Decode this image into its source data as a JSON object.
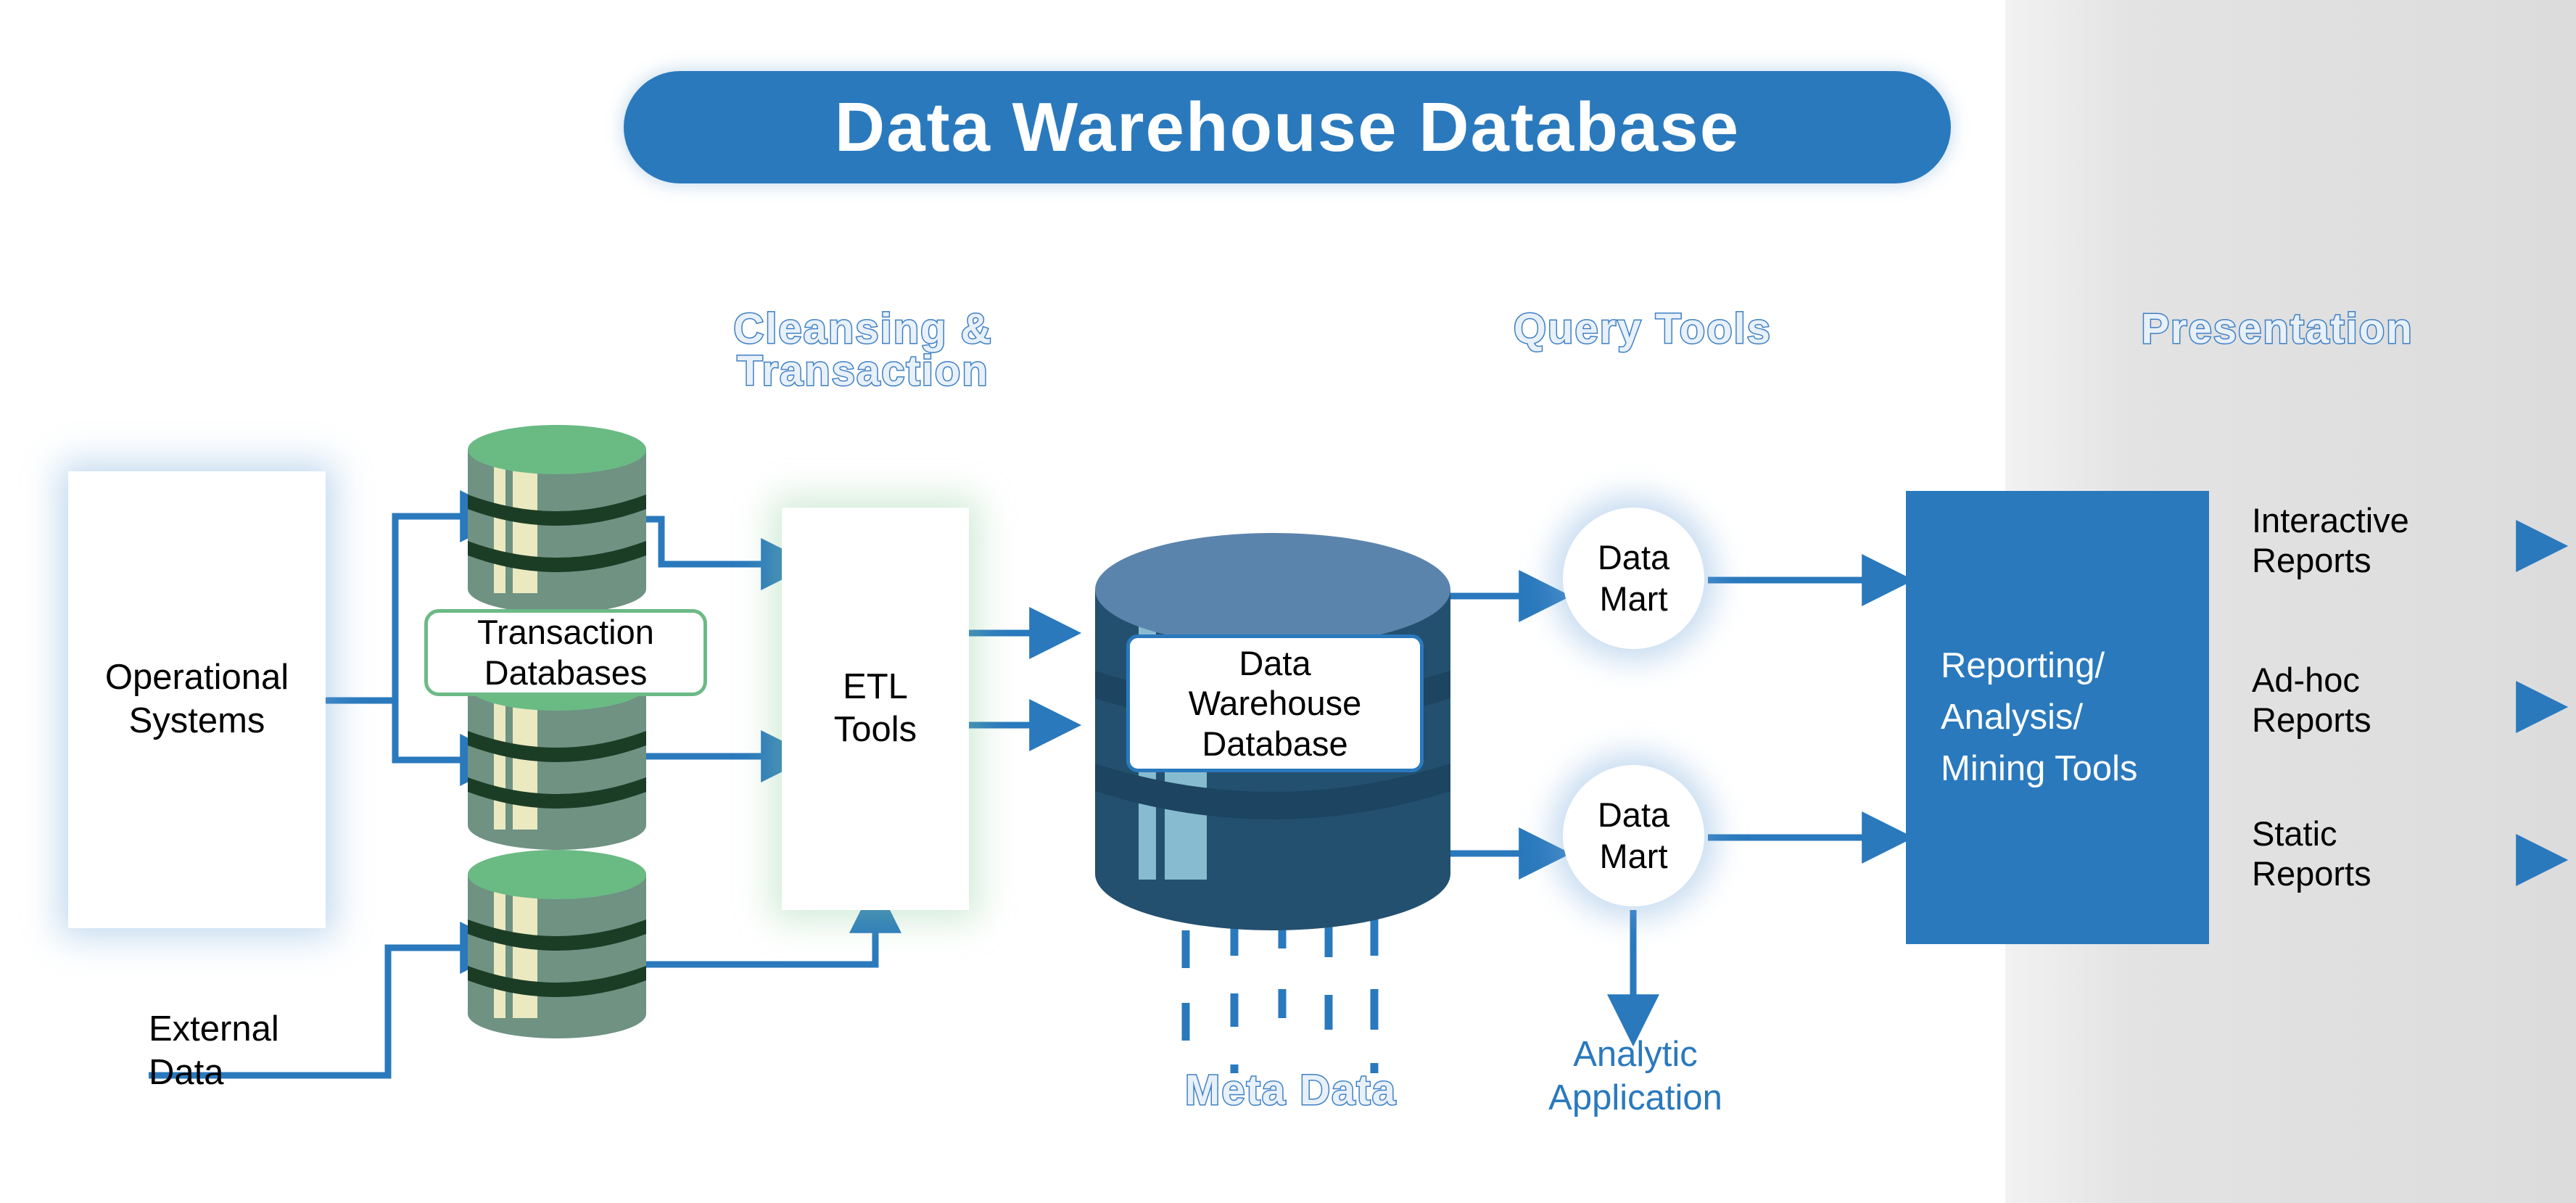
{
  "title": {
    "text": "Data Warehouse Database",
    "pill_color": "#2a79bd",
    "text_color": "#ffffff"
  },
  "section_headers": {
    "cleansing": "Cleansing &\nTransaction",
    "cleansing_line1": "Cleansing &",
    "cleansing_line2": "Transaction",
    "query_tools": "Query Tools",
    "presentation": "Presentation",
    "meta_data": "Meta Data",
    "fill_color": "#e8f0fa",
    "stroke_color": "#3f80c4"
  },
  "nodes": {
    "operational_systems": {
      "line1": "Operational",
      "line2": "Systems"
    },
    "transaction_databases": {
      "line1": "Transaction",
      "line2": "Databases",
      "border_color": "#6cba86"
    },
    "etl_tools": {
      "line1": "ETL",
      "line2": "Tools"
    },
    "data_warehouse": {
      "line1": "Data",
      "line2": "Warehouse",
      "line3": "Database",
      "border_color": "#2a79bd"
    },
    "data_mart_top": {
      "line1": "Data",
      "line2": "Mart"
    },
    "data_mart_bottom": {
      "line1": "Data",
      "line2": "Mart"
    },
    "reporting_tools": {
      "line1": "Reporting/",
      "line2": "Analysis/",
      "line3": "Mining Tools",
      "bg_color": "#2a79bd",
      "text_color": "#ffffff"
    },
    "external_data": {
      "line1": "External",
      "line2": "Data"
    },
    "analytic_application": {
      "line1": "Analytic",
      "line2": "Application",
      "color": "#2a79bd"
    }
  },
  "outputs": [
    {
      "line1": "Interactive",
      "line2": "Reports"
    },
    {
      "line1": "Ad-hoc",
      "line2": "Reports"
    },
    {
      "line1": "Static",
      "line2": "Reports"
    }
  ],
  "colors": {
    "arrow_blue": "#2a79bd",
    "db_green_top": "#6aba84",
    "db_green_body": "#6f9283",
    "db_green_band": "#1c3d25",
    "db_green_stripe": "#ebe9c0",
    "dw_top": "#5b84ad",
    "dw_body": "#23506f",
    "dw_body_dark": "#1d4460",
    "dw_stripe": "#86bbd0",
    "panel_gray": "#dcdcdc"
  }
}
